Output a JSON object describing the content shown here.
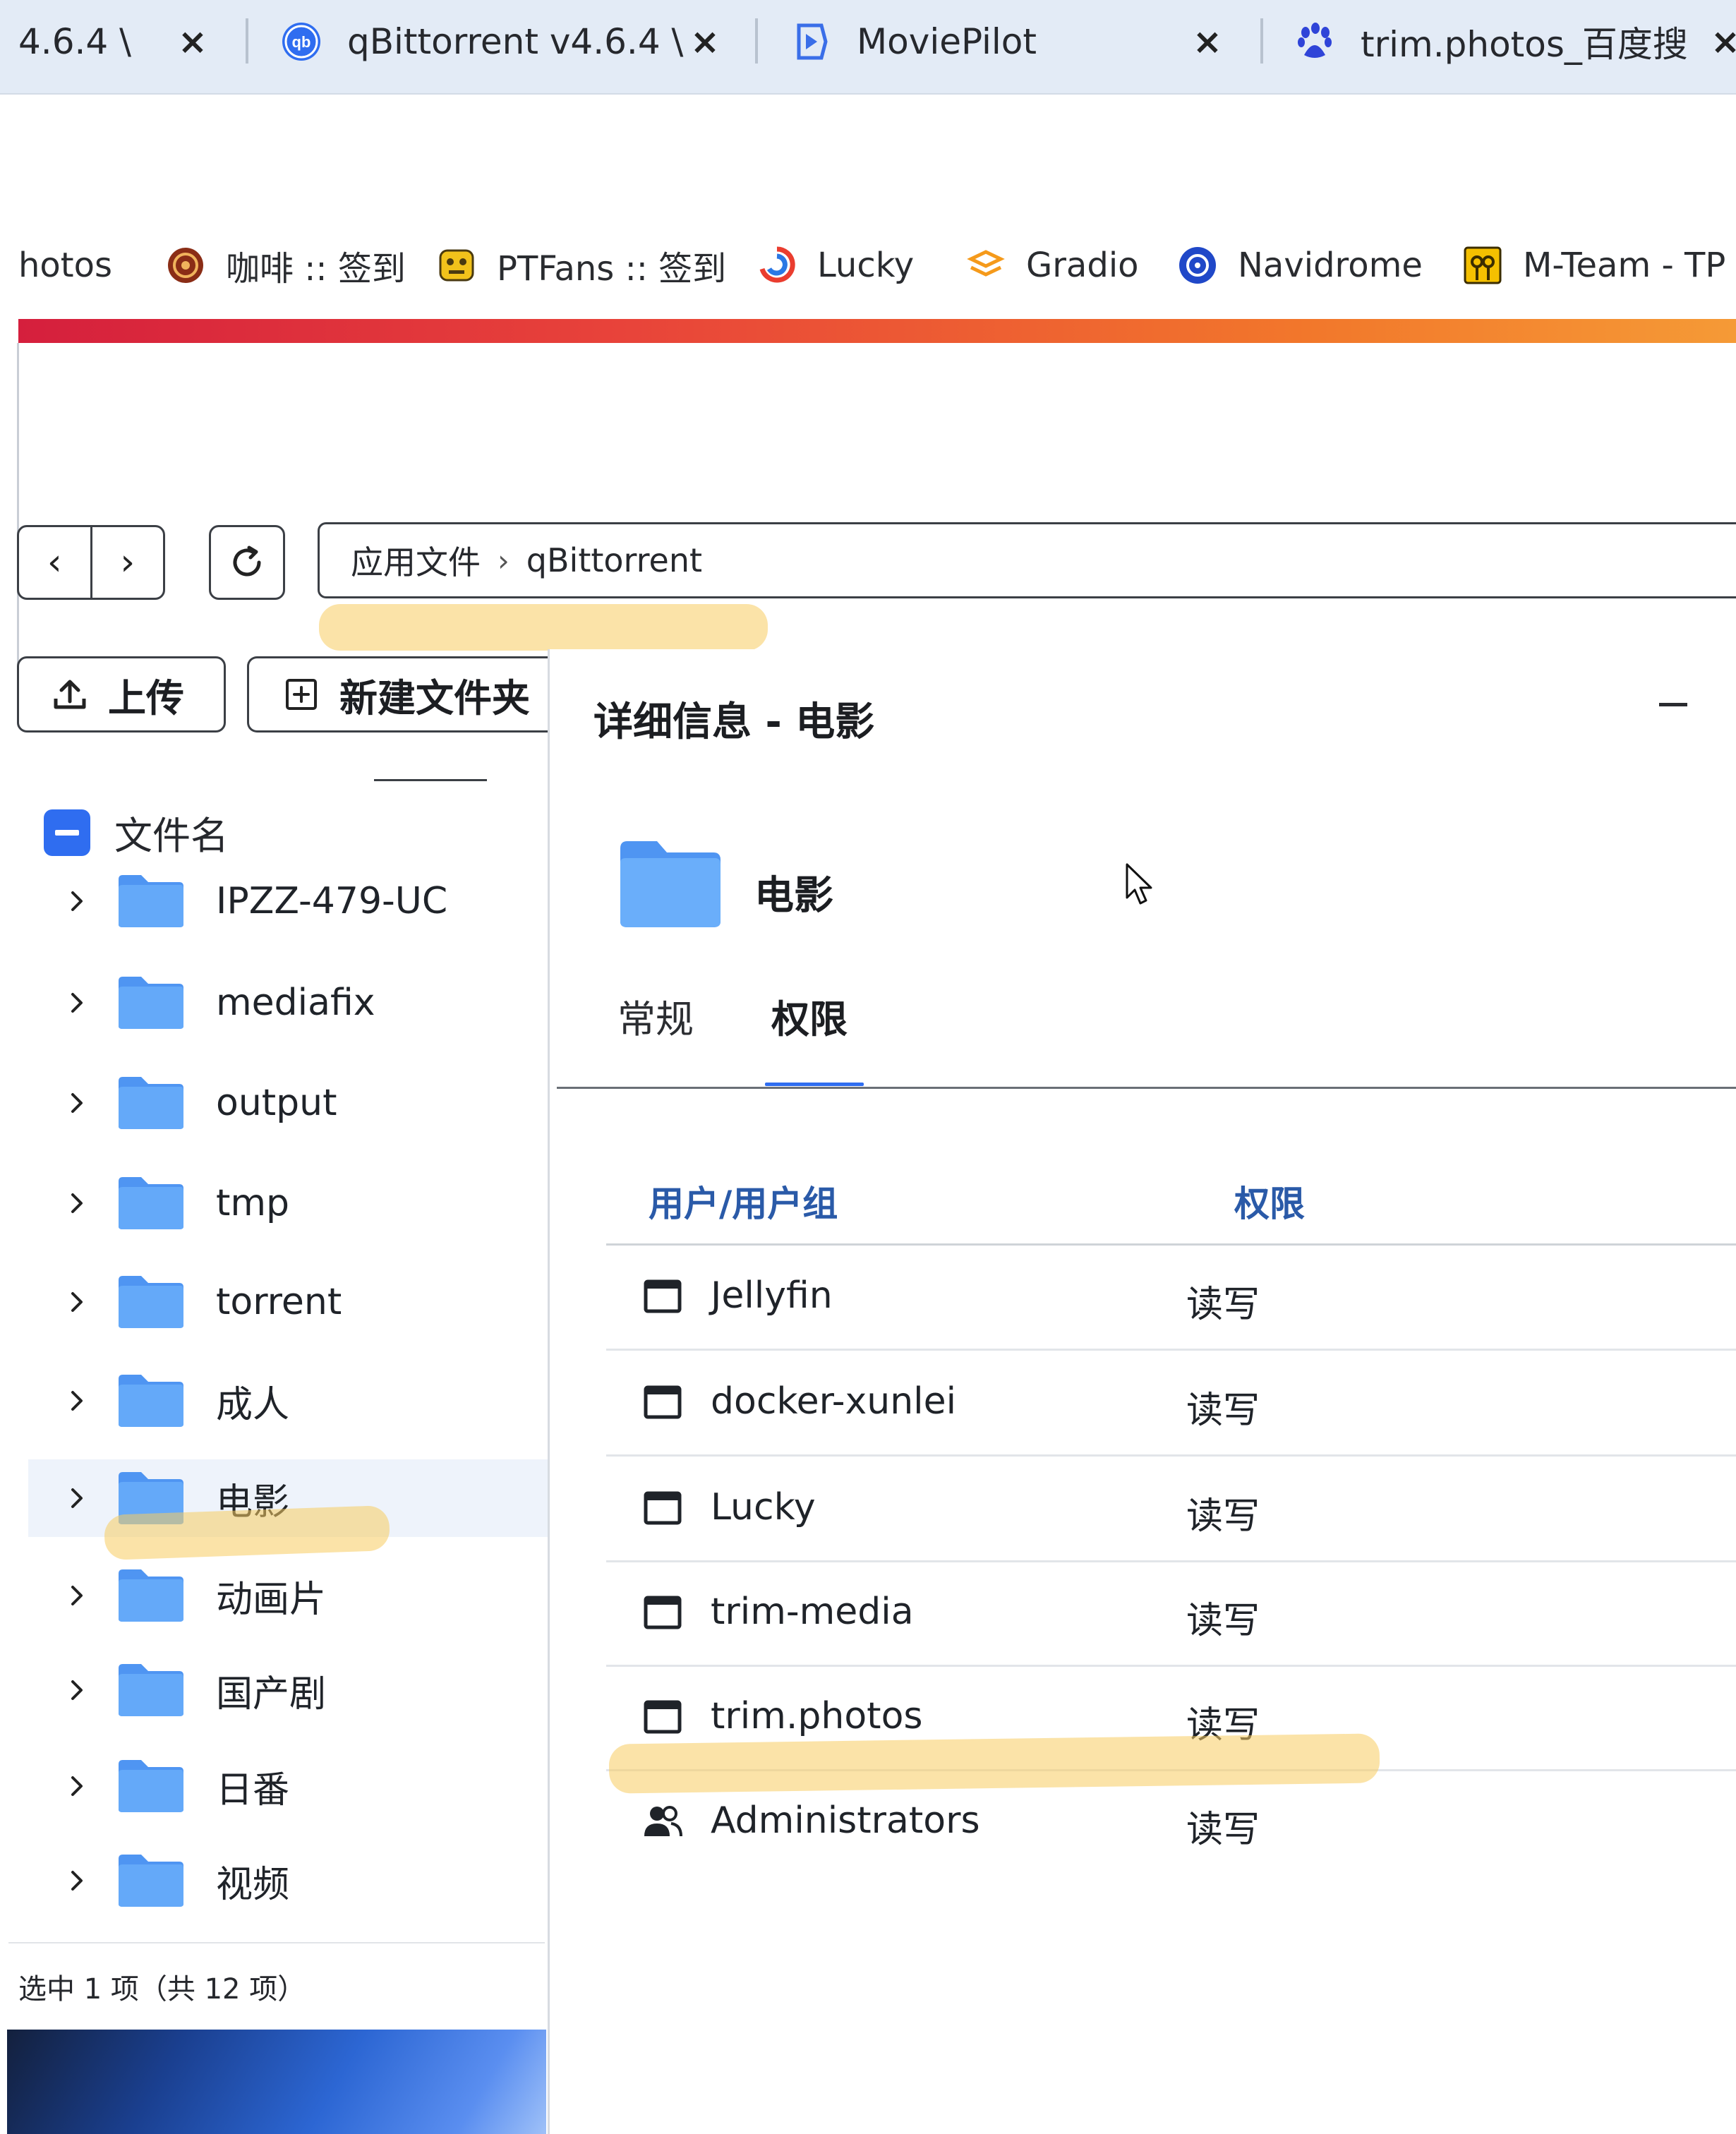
{
  "browser": {
    "tabs": [
      {
        "title": "4.6.4 \\",
        "icon": "qbittorrent-icon"
      },
      {
        "title": "qBittorrent v4.6.4 \\",
        "icon": "qbittorrent-icon"
      },
      {
        "title": "MoviePilot",
        "icon": "moviepilot-icon"
      },
      {
        "title": "trim.photos_百度搜",
        "icon": "baidu-paw-icon"
      }
    ],
    "tab_close_glyph": "×",
    "bookmarks": [
      {
        "label": "hotos",
        "icon": ""
      },
      {
        "label": "咖啡 :: 签到",
        "icon": "coffee-icon"
      },
      {
        "label": "PTFans :: 签到",
        "icon": "ptfans-icon"
      },
      {
        "label": "Lucky",
        "icon": "lucky-icon"
      },
      {
        "label": "Gradio",
        "icon": "gradio-icon"
      },
      {
        "label": "Navidrome",
        "icon": "navidrome-icon"
      },
      {
        "label": "M-Team - TP",
        "icon": "mteam-icon"
      }
    ]
  },
  "filemanager": {
    "nav": {
      "back": "‹",
      "forward": "›"
    },
    "breadcrumb": {
      "root": "应用文件",
      "separator": "›",
      "current": "qBittorrent"
    },
    "toolbar": {
      "upload": "上传",
      "new_folder": "新建文件夹"
    },
    "column_header": "文件名",
    "files": [
      {
        "name": "IPZZ-479-UC",
        "selected": false
      },
      {
        "name": "mediafix",
        "selected": false
      },
      {
        "name": "output",
        "selected": false
      },
      {
        "name": "tmp",
        "selected": false
      },
      {
        "name": "torrent",
        "selected": false
      },
      {
        "name": "成人",
        "selected": false
      },
      {
        "name": "电影",
        "selected": true
      },
      {
        "name": "动画片",
        "selected": false
      },
      {
        "name": "国产剧",
        "selected": false
      },
      {
        "name": "日番",
        "selected": false
      },
      {
        "name": "视频",
        "selected": false
      }
    ],
    "status": "选中 1 项（共 12 项）"
  },
  "details": {
    "title": "详细信息 - 电影",
    "folder_name": "电影",
    "tabs": [
      {
        "label": "常规",
        "active": false
      },
      {
        "label": "权限",
        "active": true
      }
    ],
    "permissions": {
      "header_user": "用户/用户组",
      "header_perm": "权限",
      "rows": [
        {
          "name": "Jellyfin",
          "perm": "读写",
          "icon": "app-window-icon"
        },
        {
          "name": "docker-xunlei",
          "perm": "读写",
          "icon": "app-window-icon"
        },
        {
          "name": "Lucky",
          "perm": "读写",
          "icon": "app-window-icon"
        },
        {
          "name": "trim-media",
          "perm": "读写",
          "icon": "app-window-icon"
        },
        {
          "name": "trim.photos",
          "perm": "读写",
          "icon": "app-window-icon"
        },
        {
          "name": "Administrators",
          "perm": "读写",
          "icon": "user-group-icon"
        }
      ]
    }
  },
  "colors": {
    "accent_blue": "#2f6df0",
    "folder_blue": "#5aa0f7",
    "header_blue": "#2a5aa8",
    "highlighter": "#f7cc60",
    "tabstrip_bg": "#e3ebf6"
  }
}
